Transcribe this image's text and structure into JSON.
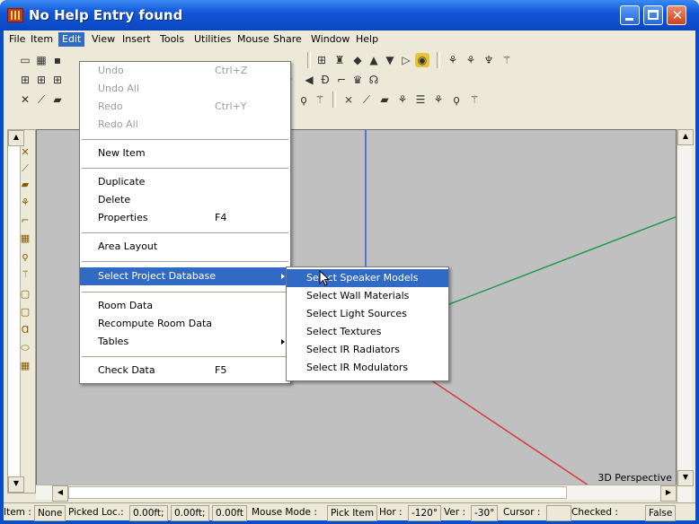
{
  "window": {
    "title": "No Help Entry found"
  },
  "menubar": {
    "items": [
      "File",
      "Item",
      "Edit",
      "View",
      "Insert",
      "Tools",
      "Utilities",
      "Mouse",
      "Share",
      "Window",
      "Help"
    ],
    "active": "Edit"
  },
  "edit_menu": {
    "undo": "Undo",
    "undo_shortcut": "Ctrl+Z",
    "undo_all": "Undo All",
    "redo": "Redo",
    "redo_shortcut": "Ctrl+Y",
    "redo_all": "Redo All",
    "new_item": "New Item",
    "duplicate": "Duplicate",
    "delete": "Delete",
    "properties": "Properties",
    "properties_shortcut": "F4",
    "area_layout": "Area Layout",
    "select_project_database": "Select Project Database",
    "room_data": "Room Data",
    "recompute_room_data": "Recompute Room Data",
    "tables": "Tables",
    "check_data": "Check Data",
    "check_data_shortcut": "F5"
  },
  "submenu": {
    "items": [
      "Select Speaker Models",
      "Select Wall Materials",
      "Select Light Sources",
      "Select Textures",
      "Select IR Radiators",
      "Select IR Modulators"
    ]
  },
  "viewport": {
    "label": "3D Perspective",
    "axis_colors": {
      "blue": "#2a5fd6",
      "green": "#1f9a4a",
      "red": "#d23a3a"
    }
  },
  "statusbar": {
    "item_label": "Item :",
    "item_value": "None",
    "picked_label": "Picked Loc.:",
    "picked_x": "0.00ft;",
    "picked_y": "0.00ft;",
    "picked_z": "0.00ft",
    "mouse_mode_label": "Mouse Mode :",
    "mouse_mode_value": "Pick Item",
    "hor_label": "Hor :",
    "hor_value": "-120°",
    "ver_label": "Ver :",
    "ver_value": "-30°",
    "cursor_label": "Cursor :",
    "checked_label": "Checked :",
    "checked_value": "False"
  },
  "icons": [
    "minimize-icon",
    "maximize-icon",
    "close-icon"
  ]
}
